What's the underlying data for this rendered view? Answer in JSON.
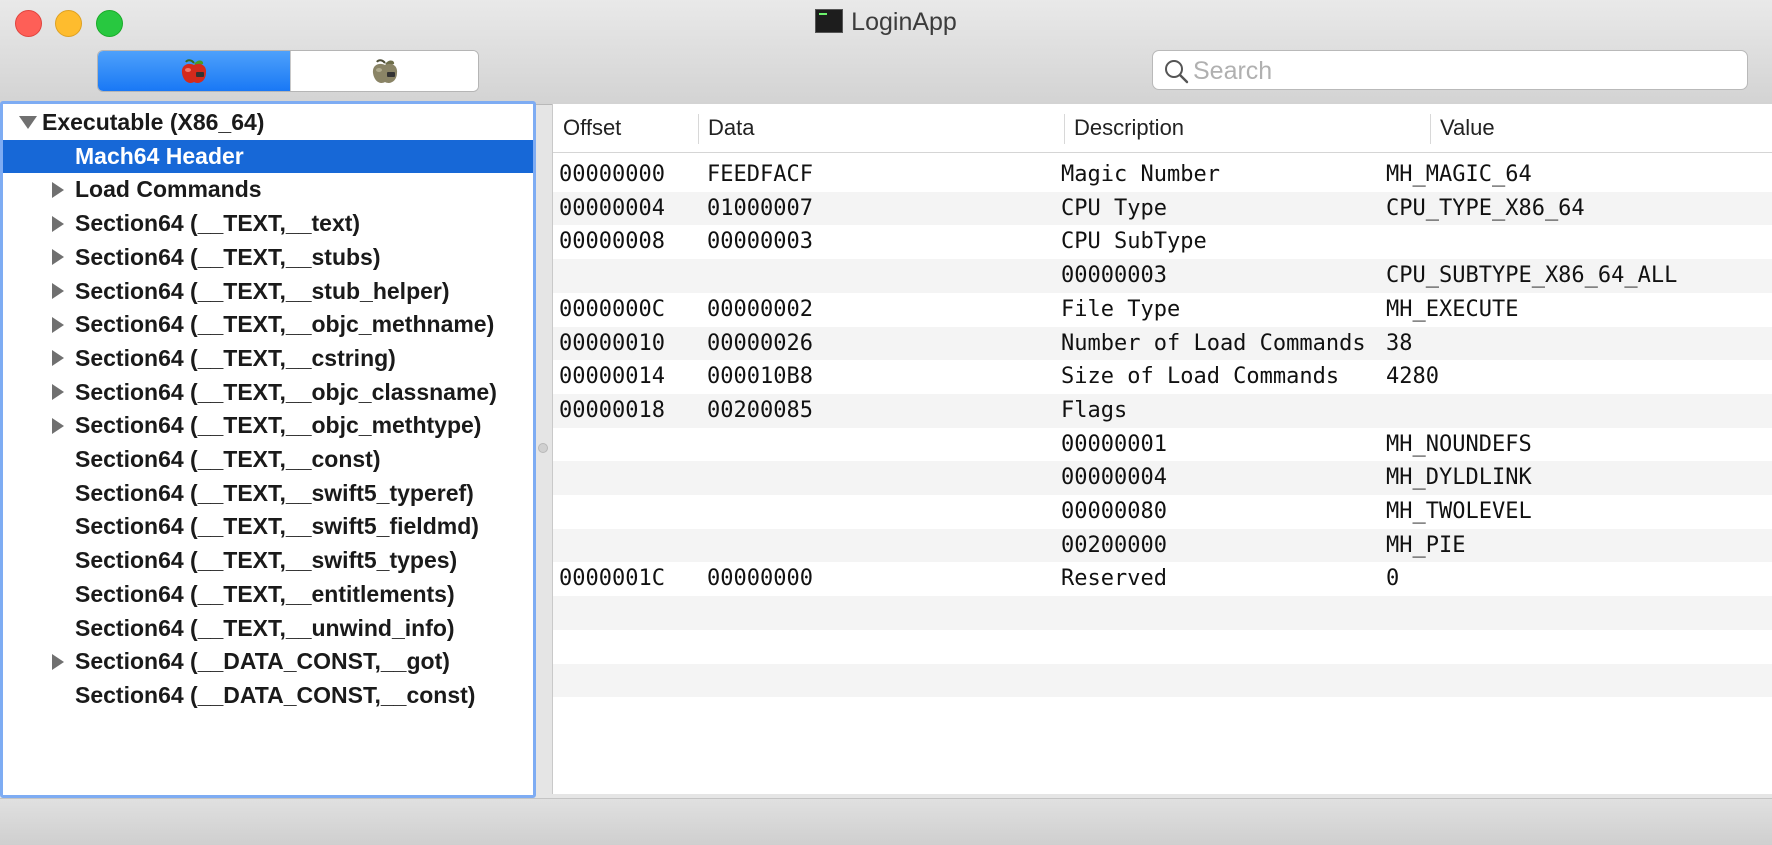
{
  "window": {
    "title": "LoginApp"
  },
  "toolbar": {
    "segment_active_icon": "red-apple-icon",
    "segment_inactive_icon": "gray-apple-icon",
    "search_placeholder": "Search"
  },
  "outline": {
    "items": [
      {
        "label": "Executable  (X86_64)",
        "disclosure": "expanded",
        "level": 0,
        "selected": false
      },
      {
        "label": "Mach64 Header",
        "disclosure": "none",
        "level": 1,
        "selected": true
      },
      {
        "label": "Load Commands",
        "disclosure": "collapsed",
        "level": 1,
        "selected": false
      },
      {
        "label": "Section64 (__TEXT,__text)",
        "disclosure": "collapsed",
        "level": 1,
        "selected": false
      },
      {
        "label": "Section64 (__TEXT,__stubs)",
        "disclosure": "collapsed",
        "level": 1,
        "selected": false
      },
      {
        "label": "Section64 (__TEXT,__stub_helper)",
        "disclosure": "collapsed",
        "level": 1,
        "selected": false
      },
      {
        "label": "Section64 (__TEXT,__objc_methname)",
        "disclosure": "collapsed",
        "level": 1,
        "selected": false
      },
      {
        "label": "Section64 (__TEXT,__cstring)",
        "disclosure": "collapsed",
        "level": 1,
        "selected": false
      },
      {
        "label": "Section64 (__TEXT,__objc_classname)",
        "disclosure": "collapsed",
        "level": 1,
        "selected": false
      },
      {
        "label": "Section64 (__TEXT,__objc_methtype)",
        "disclosure": "collapsed",
        "level": 1,
        "selected": false
      },
      {
        "label": "Section64 (__TEXT,__const)",
        "disclosure": "none",
        "level": 1,
        "selected": false
      },
      {
        "label": "Section64 (__TEXT,__swift5_typeref)",
        "disclosure": "none",
        "level": 1,
        "selected": false
      },
      {
        "label": "Section64 (__TEXT,__swift5_fieldmd)",
        "disclosure": "none",
        "level": 1,
        "selected": false
      },
      {
        "label": "Section64 (__TEXT,__swift5_types)",
        "disclosure": "none",
        "level": 1,
        "selected": false
      },
      {
        "label": "Section64 (__TEXT,__entitlements)",
        "disclosure": "none",
        "level": 1,
        "selected": false
      },
      {
        "label": "Section64 (__TEXT,__unwind_info)",
        "disclosure": "none",
        "level": 1,
        "selected": false
      },
      {
        "label": "Section64 (__DATA_CONST,__got)",
        "disclosure": "collapsed",
        "level": 1,
        "selected": false
      },
      {
        "label": "Section64 (__DATA_CONST,__const)",
        "disclosure": "none",
        "level": 1,
        "selected": false
      }
    ]
  },
  "table": {
    "columns": [
      "Offset",
      "Data",
      "Description",
      "Value"
    ],
    "rows": [
      {
        "offset": "00000000",
        "data": "FEEDFACF",
        "description": "Magic Number",
        "value": "MH_MAGIC_64"
      },
      {
        "offset": "00000004",
        "data": "01000007",
        "description": "CPU Type",
        "value": "CPU_TYPE_X86_64"
      },
      {
        "offset": "00000008",
        "data": "00000003",
        "description": "CPU SubType",
        "value": ""
      },
      {
        "offset": "",
        "data": "",
        "description": "00000003",
        "value": "CPU_SUBTYPE_X86_64_ALL"
      },
      {
        "offset": "0000000C",
        "data": "00000002",
        "description": "File Type",
        "value": "MH_EXECUTE"
      },
      {
        "offset": "00000010",
        "data": "00000026",
        "description": "Number of Load Commands",
        "value": "38"
      },
      {
        "offset": "00000014",
        "data": "000010B8",
        "description": "Size of Load Commands",
        "value": "4280"
      },
      {
        "offset": "00000018",
        "data": "00200085",
        "description": "Flags",
        "value": ""
      },
      {
        "offset": "",
        "data": "",
        "description": "00000001",
        "value": "MH_NOUNDEFS"
      },
      {
        "offset": "",
        "data": "",
        "description": "00000004",
        "value": "MH_DYLDLINK"
      },
      {
        "offset": "",
        "data": "",
        "description": "00000080",
        "value": "MH_TWOLEVEL"
      },
      {
        "offset": "",
        "data": "",
        "description": "00200000",
        "value": "MH_PIE"
      },
      {
        "offset": "0000001C",
        "data": "00000000",
        "description": "Reserved",
        "value": "0"
      }
    ],
    "empty_rows": 4
  },
  "colors": {
    "selection": "#1768d7",
    "focus_ring": "#7eacf3",
    "segment_active": "#1978f5",
    "close": "#fe5f57",
    "minimize": "#febc2e",
    "zoom": "#28c840"
  }
}
